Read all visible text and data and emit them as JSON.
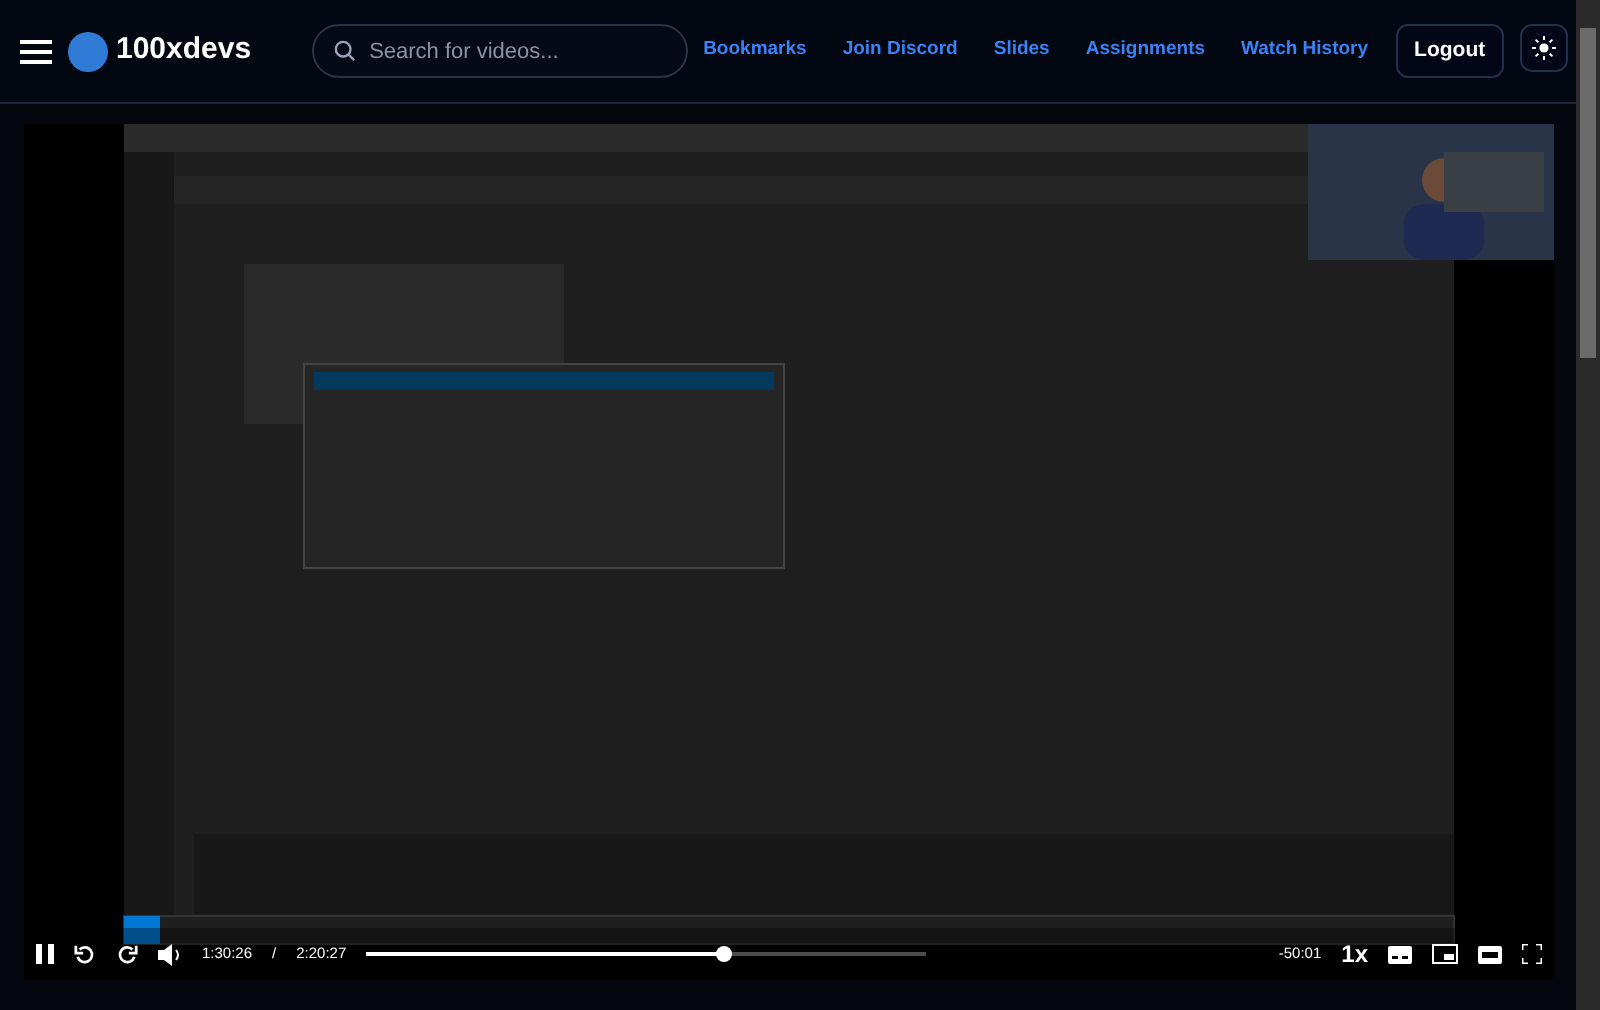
{
  "header": {
    "logo_text": "100xdevs",
    "search": {
      "placeholder": "Search for videos..."
    },
    "nav_links": [
      {
        "label": "Bookmarks"
      },
      {
        "label": "Join Discord"
      },
      {
        "label": "Slides"
      },
      {
        "label": "Assignments"
      },
      {
        "label": "Watch History"
      }
    ],
    "logout": "Logout"
  },
  "player": {
    "controls": {
      "playing": true,
      "current_time": "1:30:26",
      "separator": "/",
      "duration": "2:20:27",
      "level": 0.64,
      "remaining": "-50:01",
      "speed": "1x"
    }
  }
}
